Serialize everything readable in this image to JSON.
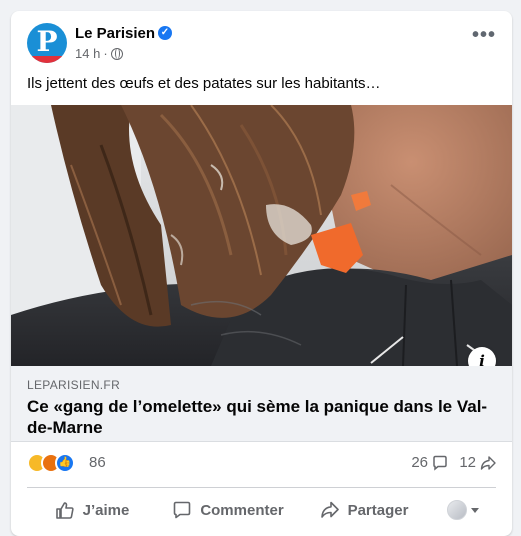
{
  "post": {
    "page_name": "Le Parisien",
    "logo_letter": "P",
    "time": "14 h",
    "separator": "·",
    "text": "Ils jettent des œufs et des patates sur les habitants…",
    "more_icon": "more-options-icon",
    "audience_icon": "globe-icon"
  },
  "link": {
    "domain": "LEPARISIEN.FR",
    "headline": "Ce «gang de l’omelette» qui sème la panique dans le Val-de-Marne",
    "info_label": "i"
  },
  "stats": {
    "reaction_count": "86",
    "reaction_icons": [
      "haha-reaction-icon",
      "angry-reaction-icon",
      "like-reaction-icon"
    ],
    "comment_count": "26",
    "share_count": "12"
  },
  "actions": {
    "like_label": "J’aime",
    "comment_label": "Commenter",
    "share_label": "Partager"
  },
  "colors": {
    "brand_blue": "#1a8fd6",
    "brand_red": "#e2313b",
    "facebook_blue": "#1877f2",
    "secondary_text": "#65676b"
  }
}
